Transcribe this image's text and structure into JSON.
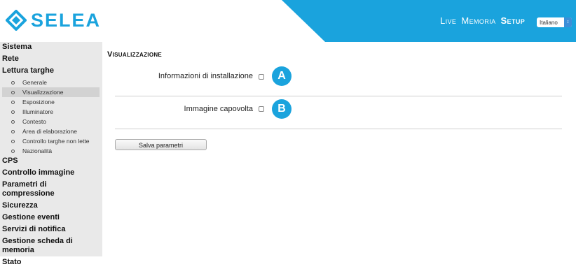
{
  "brand": {
    "name": "SELEA",
    "color": "#1aa3dd"
  },
  "header": {
    "nav": [
      {
        "label": "Live",
        "active": false
      },
      {
        "label": "Memoria",
        "active": false
      },
      {
        "label": "Setup",
        "active": true
      }
    ],
    "language": {
      "selected": "Italiano"
    },
    "accent_color": "#1aa3dd"
  },
  "sidebar": {
    "items": [
      {
        "label": "Sistema"
      },
      {
        "label": "Rete"
      },
      {
        "label": "Lettura targhe"
      },
      {
        "label": "CPS"
      },
      {
        "label": "Controllo immagine"
      },
      {
        "label": "Parametri di compressione"
      },
      {
        "label": "Sicurezza"
      },
      {
        "label": "Gestione eventi"
      },
      {
        "label": "Servizi di notifica"
      },
      {
        "label": "Gestione scheda di memoria"
      },
      {
        "label": "Stato"
      }
    ],
    "sub_items": [
      {
        "label": "Generale",
        "active": false
      },
      {
        "label": "Visualizzazione",
        "active": true
      },
      {
        "label": "Esposizione",
        "active": false
      },
      {
        "label": "Illuminatore",
        "active": false
      },
      {
        "label": "Contesto",
        "active": false
      },
      {
        "label": "Area di elaborazione",
        "active": false
      },
      {
        "label": "Controllo targhe non lette",
        "active": false
      },
      {
        "label": "Nazionalità",
        "active": false
      }
    ]
  },
  "main": {
    "title": "Visualizzazione",
    "options": [
      {
        "label": "Informazioni di installazione",
        "checked": false,
        "badge": "A"
      },
      {
        "label": "Immagine capovolta",
        "checked": false,
        "badge": "B"
      }
    ],
    "save_label": "Salva parametri"
  }
}
